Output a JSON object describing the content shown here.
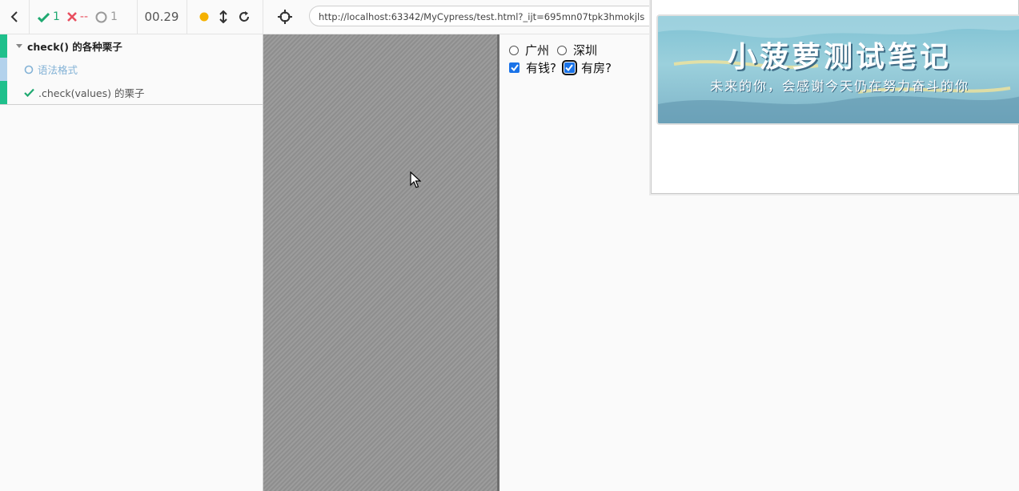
{
  "toolbar": {
    "passed_count": "1",
    "failed_count": "--",
    "pending_count": "1",
    "duration": "00.29",
    "url": "http://localhost:63342/MyCypress/test.html?_ijt=695mn07tpk3hmokjls"
  },
  "tests": {
    "suite_title": "check() 的各种栗子",
    "items": [
      {
        "label": "语法格式",
        "state": "pending"
      },
      {
        "label": ".check(values) 的栗子",
        "state": "passed"
      }
    ]
  },
  "aut": {
    "radios": [
      {
        "label": "广州",
        "checked": false
      },
      {
        "label": "深圳",
        "checked": false
      }
    ],
    "checkboxes": [
      {
        "label": "有钱?",
        "checked": true
      },
      {
        "label": "有房?",
        "checked": true
      }
    ]
  },
  "banner": {
    "title": "小菠萝测试笔记",
    "subtitle": "未来的你，会感谢今天仍在努力奋斗的你"
  },
  "colors": {
    "passed": "#1fa971",
    "failed": "#e94f5f",
    "pending_bar": "#b3d2ec",
    "checkbox": "#1a73e8",
    "indicator": "#f5b100"
  }
}
